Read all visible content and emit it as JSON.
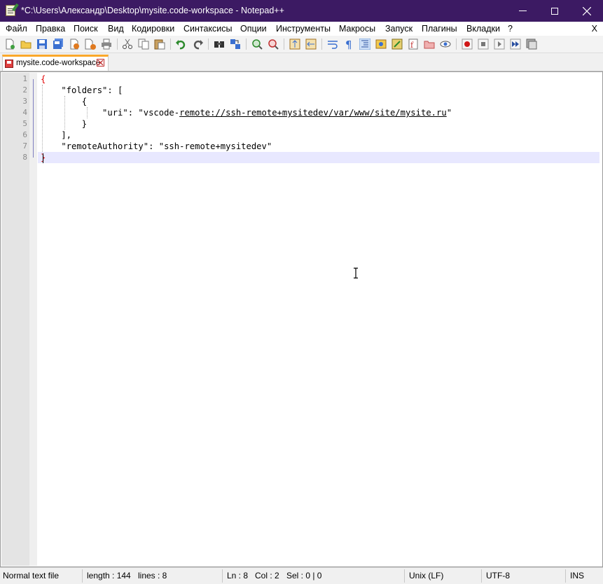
{
  "window": {
    "title": "*C:\\Users\\Александр\\Desktop\\mysite.code-workspace - Notepad++",
    "icon": "notepad-icon"
  },
  "menu": {
    "items": [
      "Файл",
      "Правка",
      "Поиск",
      "Вид",
      "Кодировки",
      "Синтаксисы",
      "Опции",
      "Инструменты",
      "Макросы",
      "Запуск",
      "Плагины",
      "Вкладки",
      "?"
    ],
    "close_label": "X"
  },
  "toolbar": {
    "icons": [
      "new-file-icon",
      "open-file-icon",
      "save-icon",
      "save-all-icon",
      "close-icon",
      "close-all-icon",
      "print-icon",
      "cut-icon",
      "copy-icon",
      "paste-icon",
      "undo-icon",
      "redo-icon",
      "find-icon",
      "replace-icon",
      "zoom-in-icon",
      "zoom-out-icon",
      "sync-vertical-icon",
      "sync-horizontal-icon",
      "word-wrap-icon",
      "show-all-chars-icon",
      "indent-guide-icon",
      "language-icon",
      "function-list-icon",
      "document-map-icon",
      "folder-workspace-icon",
      "monitoring-icon",
      "record-macro-icon",
      "stop-macro-icon",
      "play-macro-icon",
      "run-macro-multiple-icon",
      "save-macro-icon"
    ]
  },
  "tab": {
    "label": "mysite.code-workspace",
    "close_label": "x"
  },
  "editor": {
    "line_numbers": [
      "1",
      "2",
      "3",
      "4",
      "5",
      "6",
      "7",
      "8"
    ],
    "lines": {
      "l1": "{",
      "l2": "    \"folders\": [",
      "l3": "        {",
      "l4_pre": "            \"uri\": \"vscode-",
      "l4_link": "remote://ssh-remote+mysitedev/var/www/site/mysite.ru",
      "l4_post": "\"",
      "l5": "        }",
      "l6": "    ],",
      "l7": "    \"remoteAuthority\": \"ssh-remote+mysitedev\"",
      "l8": "}"
    }
  },
  "status": {
    "file_type": "Normal text file",
    "length": "length : 144",
    "lines": "lines : 8",
    "ln": "Ln : 8",
    "col": "Col : 2",
    "sel": "Sel : 0 | 0",
    "eol": "Unix (LF)",
    "encoding": "UTF-8",
    "mode": "INS"
  }
}
